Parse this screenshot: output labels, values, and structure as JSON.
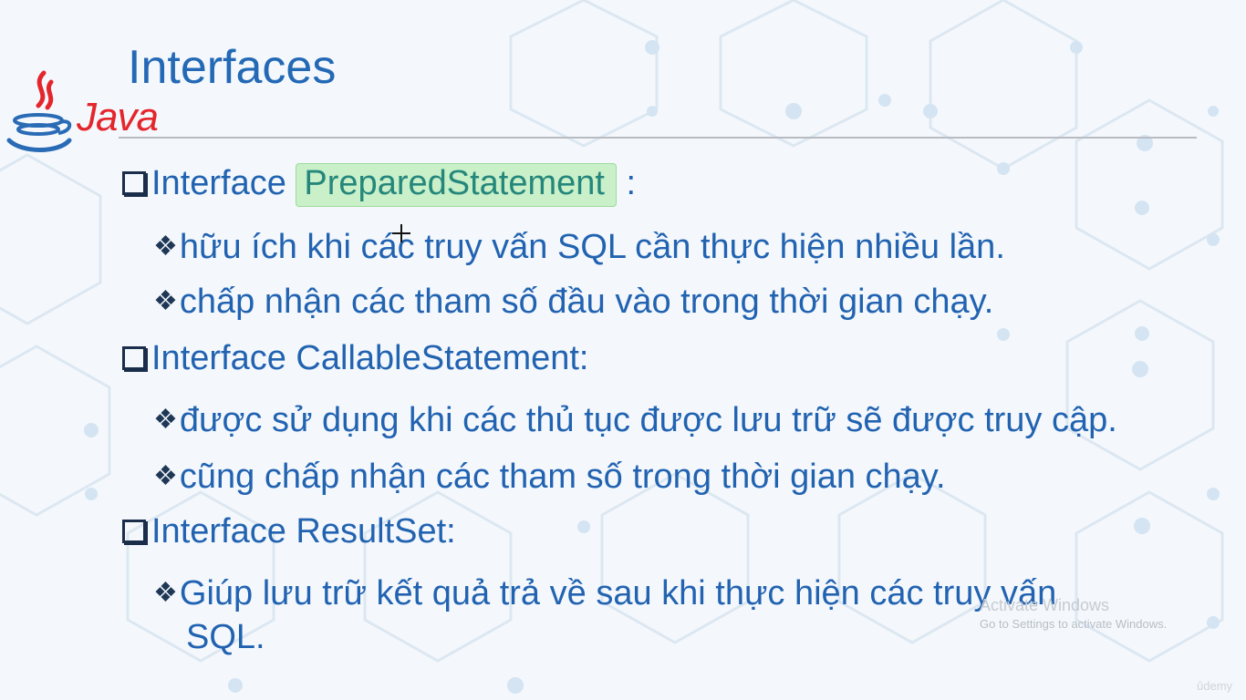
{
  "slide": {
    "title": "Interfaces",
    "logo_text": "Java",
    "items": [
      {
        "prefix": "Interface ",
        "highlight": "PreparedStatement",
        "suffix": " :"
      },
      {
        "text": "hữu ích khi các truy vấn SQL cần thực hiện nhiều lần."
      },
      {
        "text": "chấp nhận các tham số đầu vào trong thời gian chạy."
      },
      {
        "text": "Interface CallableStatement:"
      },
      {
        "text": "được sử dụng khi các thủ tục được lưu trữ sẽ được truy cập."
      },
      {
        "text": "cũng chấp nhận các tham số trong thời gian chạy."
      },
      {
        "text": "Interface ResultSet:"
      },
      {
        "text": "Giúp lưu trữ kết quả trả về sau khi thực hiện các truy vấn"
      },
      {
        "text": "SQL."
      }
    ]
  },
  "overlay": {
    "activate_title": "Activate Windows",
    "activate_sub": "Go to Settings to activate Windows.",
    "brand": "ûdemy"
  },
  "colors": {
    "text": "#2263b1",
    "highlight_bg": "#c9f0c8",
    "highlight_text": "#25877c",
    "java_red": "#e4262c"
  },
  "icons": [
    "java-logo-icon",
    "square-bullet-icon",
    "diamond-bullet-icon",
    "crosshair-cursor-icon"
  ]
}
